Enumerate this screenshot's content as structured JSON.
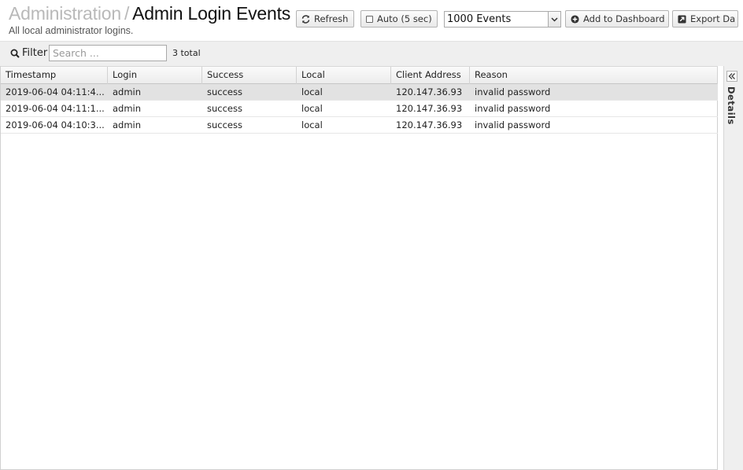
{
  "header": {
    "breadcrumb_parent": "Administration",
    "breadcrumb_sep": "/",
    "title": "Admin Login Events",
    "subtitle": "All local administrator logins."
  },
  "toolbar": {
    "refresh_label": "Refresh",
    "auto_label": "Auto (5 sec)",
    "auto_checked": false,
    "events_select_value": "1000 Events",
    "add_dashboard_label": "Add to Dashboard",
    "export_label": "Export Da"
  },
  "filter": {
    "label": "Filter",
    "placeholder": "Search ...",
    "value": "",
    "total": "3 total"
  },
  "table": {
    "columns": [
      "Timestamp",
      "Login",
      "Success",
      "Local",
      "Client Address",
      "Reason"
    ],
    "rows": [
      [
        "2019-06-04 04:11:4...",
        "admin",
        "success",
        "local",
        "120.147.36.93",
        "invalid password"
      ],
      [
        "2019-06-04 04:11:1...",
        "admin",
        "success",
        "local",
        "120.147.36.93",
        "invalid password"
      ],
      [
        "2019-06-04 04:10:3...",
        "admin",
        "success",
        "local",
        "120.147.36.93",
        "invalid password"
      ]
    ],
    "selected_row": 0
  },
  "details_panel": {
    "label": "Details"
  },
  "icons": {
    "refresh": "refresh-icon",
    "add": "plus-circle-icon",
    "export": "external-link-icon",
    "search": "search-icon",
    "collapse": "double-chevron-left-icon"
  }
}
